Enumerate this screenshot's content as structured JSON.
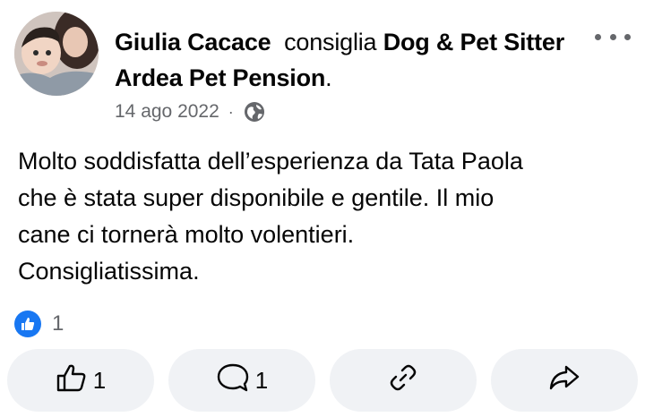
{
  "post": {
    "author": "Giulia Cacace",
    "verb": "consiglia",
    "page_name": "Dog & Pet Sitter Ardea Pet Pension",
    "page_suffix": ".",
    "date": "14 ago 2022",
    "separator": "·",
    "privacy_icon": "globe-icon",
    "body_lines": [
      "Molto soddisfatta dell’esperienza da Tata Paola",
      "che è stata super disponibile e gentile. Il mio",
      "cane ci tornerà molto volentieri.",
      "Consigliatissima."
    ]
  },
  "reactions": {
    "icon": "like-reaction-icon",
    "count": "1"
  },
  "actions": {
    "like_count": "1",
    "comment_count": "1",
    "like_icon": "thumbs-up-icon",
    "comment_icon": "comment-bubble-icon",
    "copy_link_icon": "link-icon",
    "share_icon": "share-arrow-icon"
  },
  "colors": {
    "text": "#050505",
    "secondary": "#65676b",
    "button_bg": "#f0f2f5",
    "like_blue": "#1877f2"
  }
}
